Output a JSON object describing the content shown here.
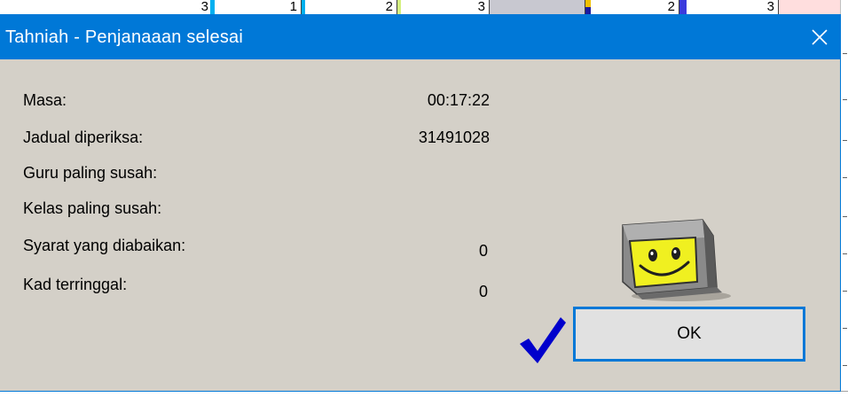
{
  "background": {
    "grid_values": [
      "3",
      "1",
      "2",
      "3",
      "2",
      "3"
    ]
  },
  "dialog": {
    "title": "Tahniah - Penjanaaan selesai",
    "close_glyph": "✕",
    "stats": [
      {
        "label": "Masa:",
        "value": "00:17:22"
      },
      {
        "label": "Jadual diperiksa:",
        "value": "31491028"
      },
      {
        "label": "Guru paling susah:",
        "value": ""
      },
      {
        "label": "Kelas paling susah:",
        "value": ""
      },
      {
        "label": "Syarat yang diabaikan:",
        "value": "0"
      },
      {
        "label": "Kad terringgal:",
        "value": "0"
      }
    ],
    "ok_label": "OK"
  },
  "colors": {
    "titlebar": "#0078d7",
    "dialog_bg": "#d4d0c8",
    "checkmark": "#0000cc",
    "mascot_face": "#f0f020"
  },
  "icons": [
    "close-icon",
    "checkmark-icon",
    "smiling-computer-icon"
  ]
}
